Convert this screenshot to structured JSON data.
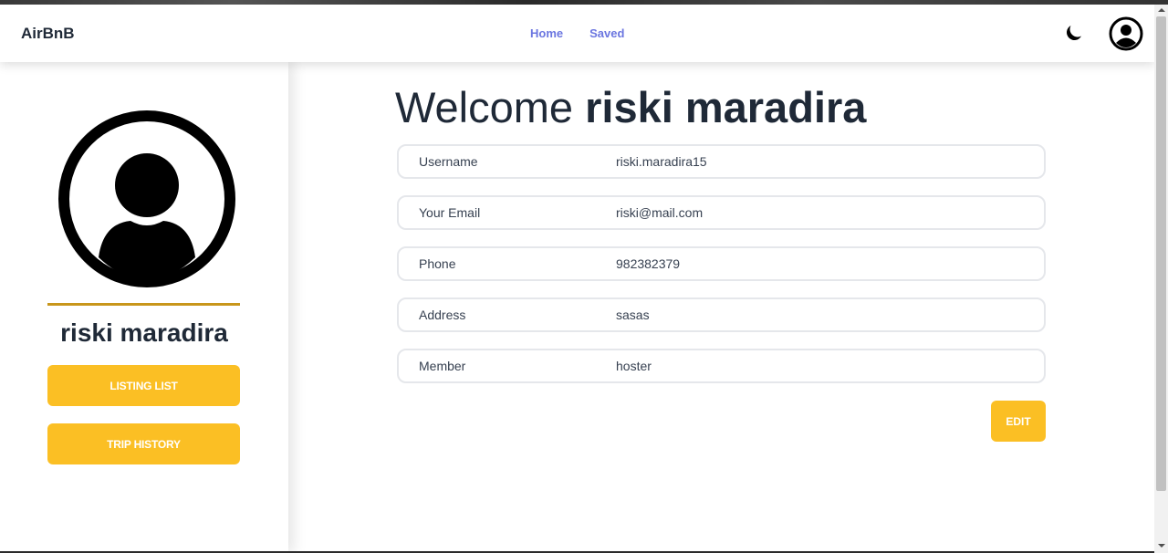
{
  "navbar": {
    "brand": "AirBnB",
    "links": [
      {
        "label": "Home"
      },
      {
        "label": "Saved"
      }
    ],
    "icons": [
      "moon-icon",
      "user-circle-icon"
    ]
  },
  "sidebar": {
    "avatar_icon": "user-circle-icon",
    "name": "riski maradira",
    "buttons": [
      {
        "label": "LISTING LIST"
      },
      {
        "label": "TRIP HISTORY"
      }
    ]
  },
  "main": {
    "welcome_prefix": "Welcome",
    "welcome_name": "riski maradira",
    "fields": [
      {
        "label": "Username",
        "value": "riski.maradira15"
      },
      {
        "label": "Your Email",
        "value": "riski@mail.com"
      },
      {
        "label": "Phone",
        "value": "982382379"
      },
      {
        "label": "Address",
        "value": "sasas"
      },
      {
        "label": "Member",
        "value": "hoster"
      }
    ],
    "edit_label": "EDIT"
  },
  "colors": {
    "accent": "#fbbf24",
    "nav_link": "#6b76e0",
    "divider": "#c8961b",
    "text": "#1f2937"
  }
}
